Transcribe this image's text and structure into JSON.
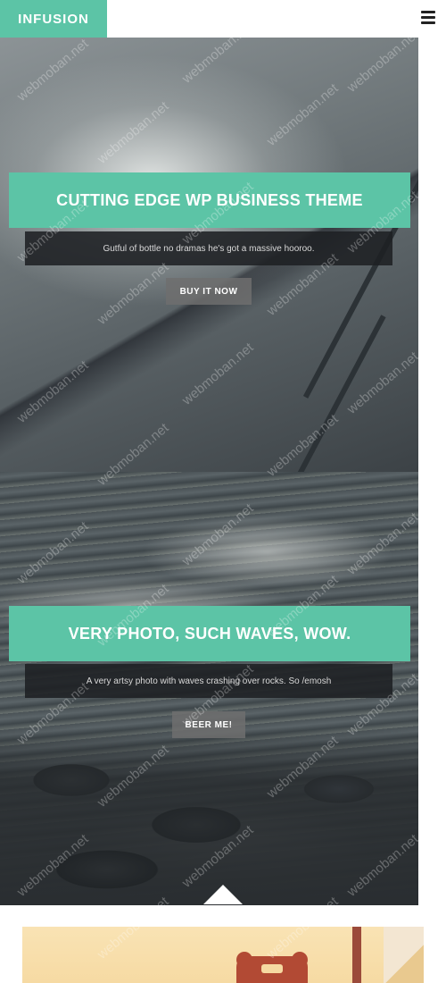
{
  "header": {
    "logo_text": "INFUSION",
    "menu_icon": "hamburger-menu-icon"
  },
  "slides": [
    {
      "title": "CUTTING EDGE WP BUSINESS THEME",
      "subtitle": "Gutful of bottle no dramas he's got a massive hooroo.",
      "button_label": "BUY IT NOW"
    },
    {
      "title": "VERY PHOTO, SUCH WAVES, WOW.",
      "subtitle": "A very artsy photo with waves crashing over rocks. So /emosh",
      "button_label": "BEER ME!"
    }
  ],
  "watermark": "webmoban.net",
  "colors": {
    "accent": "#5cc4a6",
    "subtitle_bg": "#1e2023",
    "button_bg": "#6e6e6e"
  }
}
